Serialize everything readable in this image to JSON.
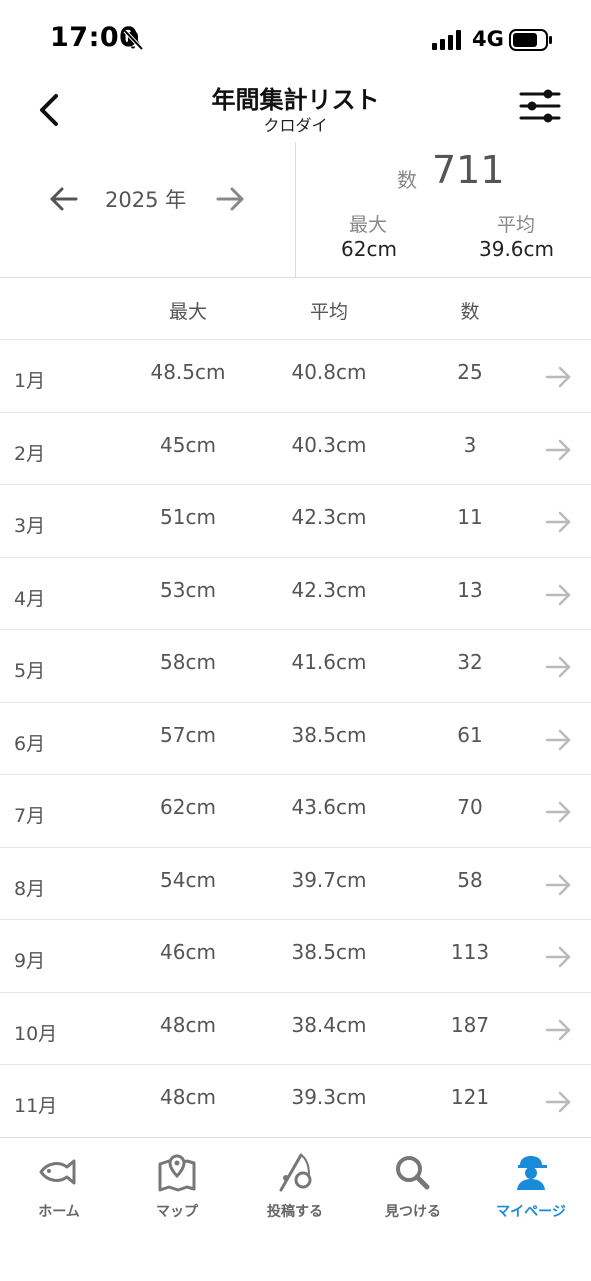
{
  "status_bar": {
    "time": "17:00",
    "network": "4G"
  },
  "header": {
    "title": "年間集計リスト",
    "subtitle": "クロダイ"
  },
  "summary": {
    "year": "2025 年",
    "count_label": "数",
    "count_value": "711",
    "max_label": "最大",
    "max_value": "62cm",
    "avg_label": "平均",
    "avg_value": "39.6cm"
  },
  "table": {
    "columns": [
      "最大",
      "平均",
      "数"
    ],
    "rows": [
      {
        "month": "1月",
        "max": "48.5cm",
        "avg": "40.8cm",
        "count": "25"
      },
      {
        "month": "2月",
        "max": "45cm",
        "avg": "40.3cm",
        "count": "3"
      },
      {
        "month": "3月",
        "max": "51cm",
        "avg": "42.3cm",
        "count": "11"
      },
      {
        "month": "4月",
        "max": "53cm",
        "avg": "42.3cm",
        "count": "13"
      },
      {
        "month": "5月",
        "max": "58cm",
        "avg": "41.6cm",
        "count": "32"
      },
      {
        "month": "6月",
        "max": "57cm",
        "avg": "38.5cm",
        "count": "61"
      },
      {
        "month": "7月",
        "max": "62cm",
        "avg": "43.6cm",
        "count": "70"
      },
      {
        "month": "8月",
        "max": "54cm",
        "avg": "39.7cm",
        "count": "58"
      },
      {
        "month": "9月",
        "max": "46cm",
        "avg": "38.5cm",
        "count": "113"
      },
      {
        "month": "10月",
        "max": "48cm",
        "avg": "38.4cm",
        "count": "187"
      },
      {
        "month": "11月",
        "max": "48cm",
        "avg": "39.3cm",
        "count": "121"
      }
    ]
  },
  "tab_bar": {
    "items": [
      {
        "label": "ホーム",
        "icon": "fish-icon"
      },
      {
        "label": "マップ",
        "icon": "map-icon"
      },
      {
        "label": "投稿する",
        "icon": "fishing-rod-icon"
      },
      {
        "label": "見つける",
        "icon": "search-icon"
      },
      {
        "label": "マイページ",
        "icon": "user-cap-icon"
      }
    ],
    "active_index": 4
  },
  "colors": {
    "accent": "#1a8bd8",
    "text": "#555555",
    "divider": "#e6e6e6"
  }
}
